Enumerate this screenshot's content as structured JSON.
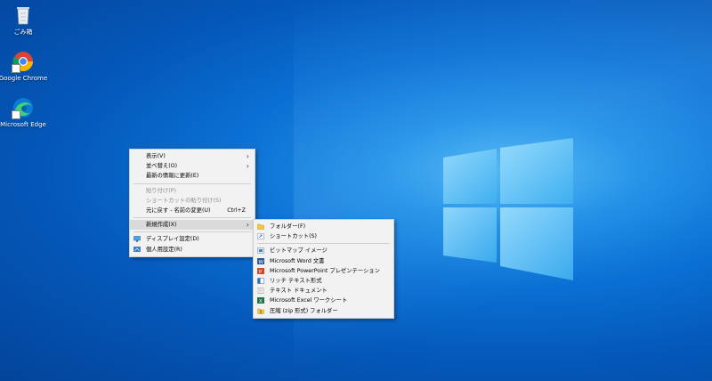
{
  "desktop": {
    "icons": [
      {
        "label": "ごみ箱",
        "icon": "recycle-bin-icon"
      },
      {
        "label": "Google Chrome",
        "icon": "chrome-icon"
      },
      {
        "label": "Microsoft Edge",
        "icon": "edge-icon"
      }
    ]
  },
  "context_menu": {
    "items": [
      {
        "label": "表示(V)",
        "submenu": true
      },
      {
        "label": "並べ替え(O)",
        "submenu": true
      },
      {
        "label": "最新の情報に更新(E)"
      },
      {
        "label": "貼り付け(P)",
        "disabled": true
      },
      {
        "label": "ショートカットの貼り付け(S)",
        "disabled": true
      },
      {
        "label": "元に戻す - 名前の変更(U)",
        "shortcut": "Ctrl+Z"
      },
      {
        "label": "新規作成(X)",
        "submenu": true
      },
      {
        "label": "ディスプレイ設定(D)",
        "icon": "display-icon"
      },
      {
        "label": "個人用設定(R)",
        "icon": "personalize-icon"
      }
    ]
  },
  "submenu_new": {
    "items": [
      {
        "label": "フォルダー(F)",
        "icon": "folder-icon"
      },
      {
        "label": "ショートカット(S)",
        "icon": "shortcut-icon"
      },
      {
        "label": "ビットマップ イメージ",
        "icon": "bitmap-icon"
      },
      {
        "label": "Microsoft Word 文書",
        "icon": "word-icon"
      },
      {
        "label": "Microsoft PowerPoint プレゼンテーション",
        "icon": "powerpoint-icon"
      },
      {
        "label": "リッチ テキスト形式",
        "icon": "rtf-icon"
      },
      {
        "label": "テキスト ドキュメント",
        "icon": "text-icon"
      },
      {
        "label": "Microsoft Excel ワークシート",
        "icon": "excel-icon"
      },
      {
        "label": "圧縮 (zip 形式) フォルダー",
        "icon": "zip-folder-icon"
      }
    ]
  },
  "colors": {
    "desktop_blue": "#0a6fd3",
    "menu_bg": "#f2f2f2",
    "highlight": "#dadada"
  }
}
